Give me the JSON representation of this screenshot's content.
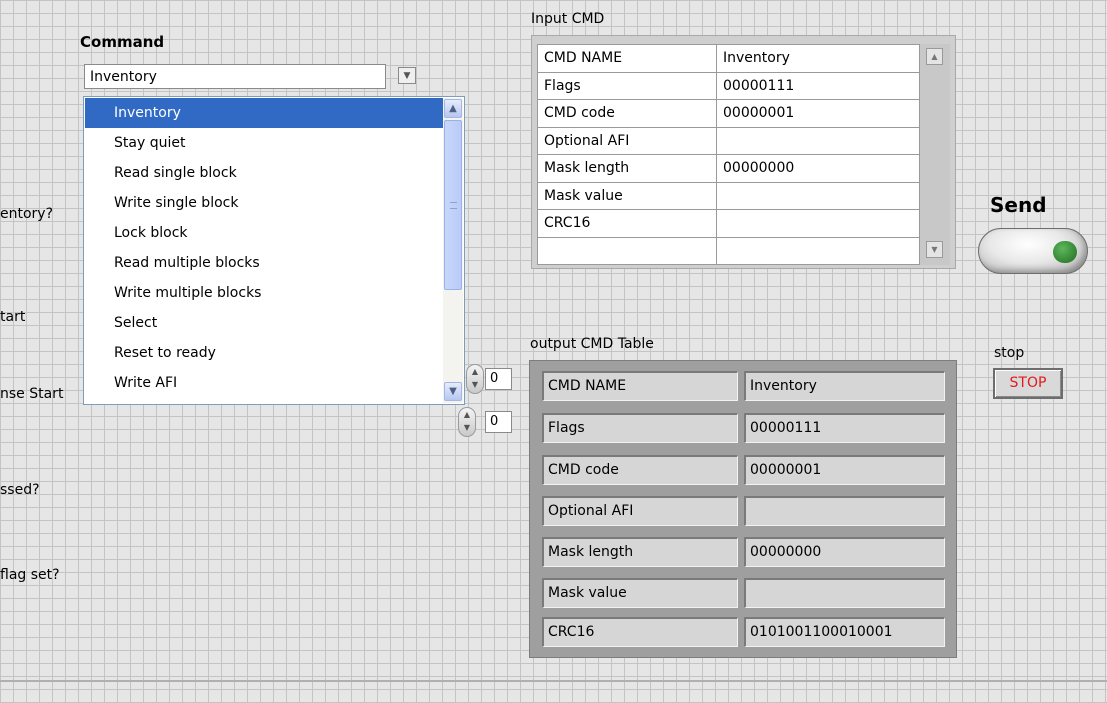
{
  "command": {
    "label": "Command",
    "selected": "Inventory",
    "dropdown_icon": "triangle-down-icon",
    "options": [
      "Inventory",
      "Stay quiet",
      "Read single block",
      "Write single block",
      "Lock block",
      "Read multiple blocks",
      "Write multiple blocks",
      "Select",
      "Reset to ready",
      "Write AFI"
    ],
    "highlighted_option": "Inventory"
  },
  "left_labels": [
    "entory?",
    "tart",
    "nse Start",
    "ssed?",
    "flag set?"
  ],
  "spinners": [
    {
      "value": "0"
    },
    {
      "value": "0"
    }
  ],
  "input_cmd": {
    "title": "Input CMD",
    "rows": [
      [
        "CMD NAME",
        "Inventory"
      ],
      [
        "Flags",
        "00000111"
      ],
      [
        "CMD code",
        "00000001"
      ],
      [
        "Optional AFI",
        ""
      ],
      [
        "Mask length",
        "00000000"
      ],
      [
        "Mask value",
        ""
      ],
      [
        "CRC16",
        ""
      ],
      [
        "",
        ""
      ]
    ]
  },
  "send": {
    "label": "Send",
    "led_color": "#2f8a2f"
  },
  "stop": {
    "label": "stop",
    "button_text": "STOP",
    "text_color": "#e21a1a"
  },
  "output_cmd": {
    "title": "output CMD Table",
    "rows": [
      [
        "CMD NAME",
        "Inventory"
      ],
      [
        "Flags",
        "00000111"
      ],
      [
        "CMD code",
        "00000001"
      ],
      [
        "Optional AFI",
        ""
      ],
      [
        "Mask length",
        "00000000"
      ],
      [
        "Mask value",
        ""
      ],
      [
        "CRC16",
        "0101001100010001"
      ]
    ]
  },
  "colors": {
    "panel_background": "#e6e6e6",
    "grid_line": "#c4c4c4",
    "selection": "#316ac5"
  }
}
